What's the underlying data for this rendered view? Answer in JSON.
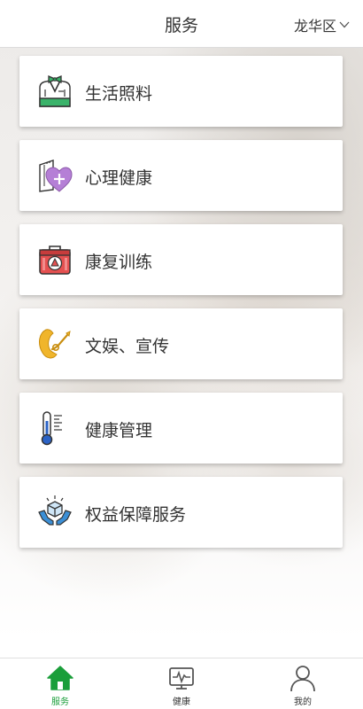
{
  "header": {
    "title": "服务",
    "region": "龙华区"
  },
  "services": [
    {
      "label": "生活照料",
      "icon": "caregiver-icon"
    },
    {
      "label": "心理健康",
      "icon": "heart-plus-icon"
    },
    {
      "label": "康复训练",
      "icon": "medical-kit-icon"
    },
    {
      "label": "文娱、宣传",
      "icon": "instrument-icon"
    },
    {
      "label": "健康管理",
      "icon": "thermometer-icon"
    },
    {
      "label": "权益保障服务",
      "icon": "protection-hands-icon"
    }
  ],
  "tabbar": {
    "tabs": [
      {
        "label": "服务",
        "icon": "home-icon",
        "active": true
      },
      {
        "label": "健康",
        "icon": "health-monitor-icon",
        "active": false
      },
      {
        "label": "我的",
        "icon": "user-icon",
        "active": false
      }
    ],
    "active_color": "#1a9e3a"
  }
}
